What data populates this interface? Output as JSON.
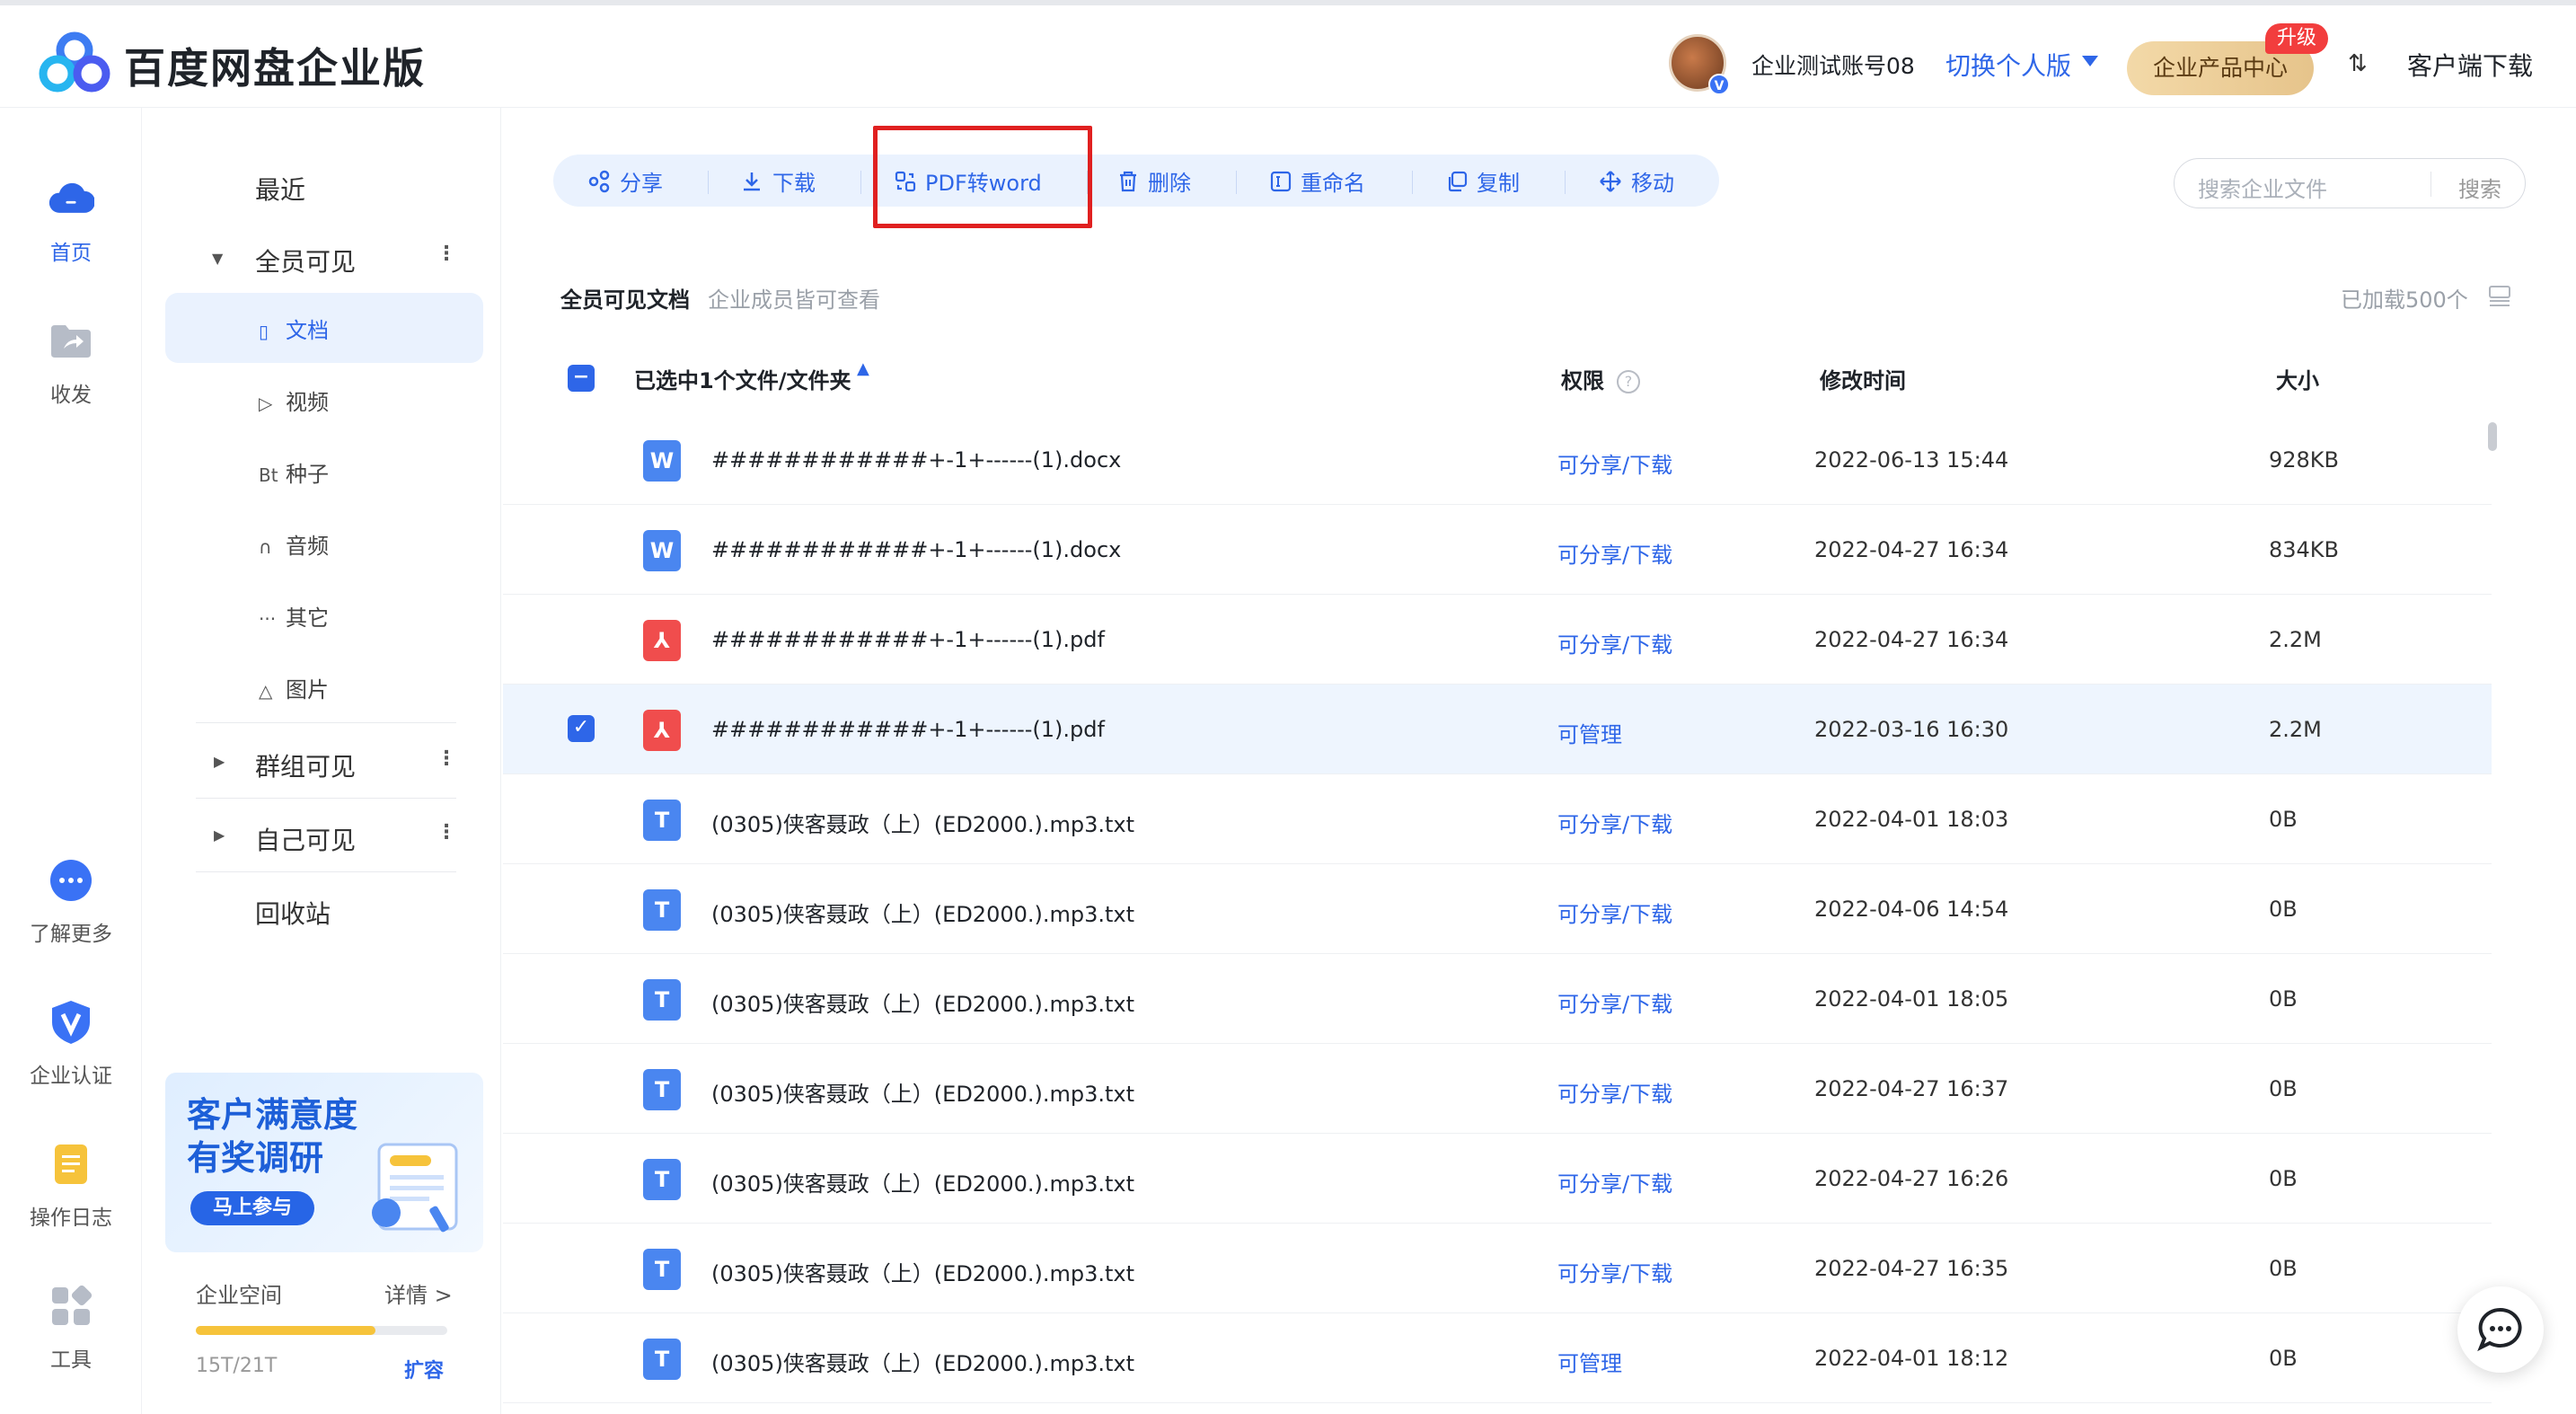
{
  "header": {
    "brand": "百度网盘企业版",
    "account": "企业测试账号08",
    "switch_label": "切换个人版",
    "product_center": "企业产品中心",
    "upgrade_badge": "升级",
    "sort_icon": "⇅",
    "client_download": "客户端下载"
  },
  "leftnav": [
    {
      "label": "首页",
      "icon": "cloud-icon"
    },
    {
      "label": "收发",
      "icon": "share-folder-icon"
    },
    {
      "label": "了解更多",
      "icon": "more-chat-icon"
    },
    {
      "label": "企业认证",
      "icon": "verify-shield-icon"
    },
    {
      "label": "操作日志",
      "icon": "log-doc-icon"
    },
    {
      "label": "工具",
      "icon": "tools-grid-icon"
    }
  ],
  "sidebar": {
    "recent": "最近",
    "all_visible": "全员可见",
    "subs": [
      {
        "label": "文档",
        "icon": "▯"
      },
      {
        "label": "视频",
        "icon": "▷"
      },
      {
        "label": "种子",
        "icon": "Bt"
      },
      {
        "label": "音频",
        "icon": "∩"
      },
      {
        "label": "其它",
        "icon": "···"
      },
      {
        "label": "图片",
        "icon": "△"
      }
    ],
    "group_visible": "群组可见",
    "self_visible": "自己可见",
    "recycle": "回收站",
    "banner_line1": "客户满意度",
    "banner_line2": "有奖调研",
    "banner_button": "马上参与",
    "space_label": "企业空间",
    "detail_link": "详情 >",
    "capacity": "15T/21T",
    "capacity_fraction": 0.714,
    "expand": "扩容"
  },
  "toolbar": {
    "share": "分享",
    "download": "下载",
    "pdf2word": "PDF转word",
    "delete": "删除",
    "rename": "重命名",
    "copy": "复制",
    "move": "移动"
  },
  "search": {
    "placeholder": "搜索企业文件",
    "button": "搜索"
  },
  "section": {
    "title": "全员可见文档",
    "subtitle": "企业成员皆可查看",
    "loaded": "已加载500个"
  },
  "table": {
    "selected_header": "已选中1个文件/文件夹",
    "col_perm": "权限",
    "col_time": "修改时间",
    "col_size": "大小",
    "rows": [
      {
        "name": "############+-1+------(1).docx",
        "type": "word",
        "perm": "可分享/下载",
        "time": "2022-06-13 15:44",
        "size": "928KB",
        "selected": false
      },
      {
        "name": "############+-1+------(1).docx",
        "type": "word",
        "perm": "可分享/下载",
        "time": "2022-04-27 16:34",
        "size": "834KB",
        "selected": false
      },
      {
        "name": "############+-1+------(1).pdf",
        "type": "pdf",
        "perm": "可分享/下载",
        "time": "2022-04-27 16:34",
        "size": "2.2M",
        "selected": false
      },
      {
        "name": "############+-1+------(1).pdf",
        "type": "pdf",
        "perm": "可管理",
        "time": "2022-03-16 16:30",
        "size": "2.2M",
        "selected": true
      },
      {
        "name": "(0305)侠客聂政（上）(ED2000.).mp3.txt",
        "type": "txt",
        "perm": "可分享/下载",
        "time": "2022-04-01 18:03",
        "size": "0B",
        "selected": false
      },
      {
        "name": "(0305)侠客聂政（上）(ED2000.).mp3.txt",
        "type": "txt",
        "perm": "可分享/下载",
        "time": "2022-04-06 14:54",
        "size": "0B",
        "selected": false
      },
      {
        "name": "(0305)侠客聂政（上）(ED2000.).mp3.txt",
        "type": "txt",
        "perm": "可分享/下载",
        "time": "2022-04-01 18:05",
        "size": "0B",
        "selected": false
      },
      {
        "name": "(0305)侠客聂政（上）(ED2000.).mp3.txt",
        "type": "txt",
        "perm": "可分享/下载",
        "time": "2022-04-27 16:37",
        "size": "0B",
        "selected": false
      },
      {
        "name": "(0305)侠客聂政（上）(ED2000.).mp3.txt",
        "type": "txt",
        "perm": "可分享/下载",
        "time": "2022-04-27 16:26",
        "size": "0B",
        "selected": false
      },
      {
        "name": "(0305)侠客聂政（上）(ED2000.).mp3.txt",
        "type": "txt",
        "perm": "可分享/下载",
        "time": "2022-04-27 16:35",
        "size": "0B",
        "selected": false
      },
      {
        "name": "(0305)侠客聂政（上）(ED2000.).mp3.txt",
        "type": "txt",
        "perm": "可管理",
        "time": "2022-04-01 18:12",
        "size": "0B",
        "selected": false
      }
    ]
  },
  "colors": {
    "accent": "#2e66e8",
    "word": "#4a86f0",
    "pdf": "#f04d4d",
    "txt": "#4a86f0",
    "highlight": "#e02020"
  }
}
